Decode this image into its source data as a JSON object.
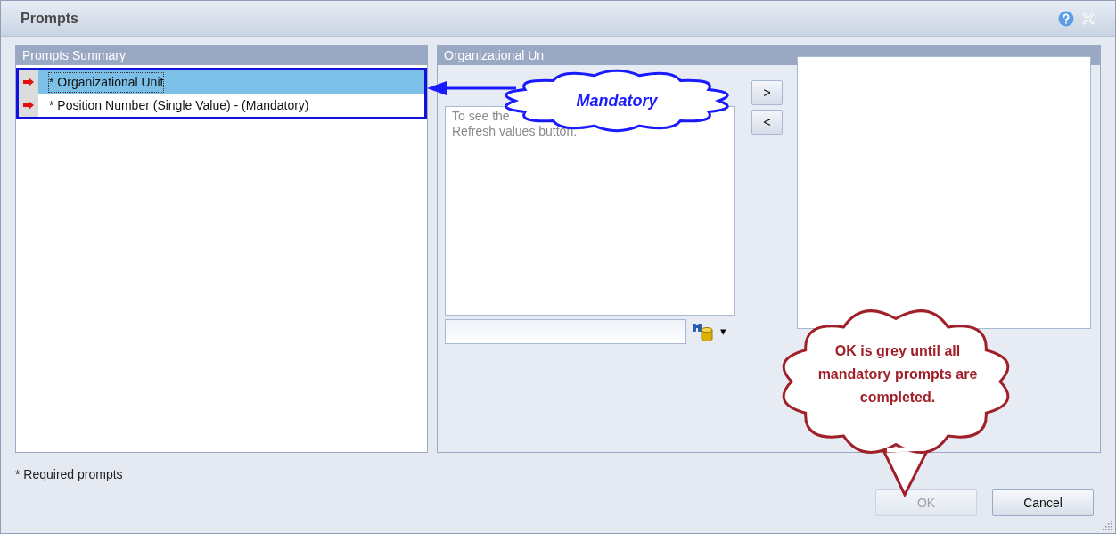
{
  "window": {
    "title": "Prompts"
  },
  "prompts_summary": {
    "title": "Prompts Summary",
    "items": [
      {
        "label": "* Organizational Unit",
        "selected": true
      },
      {
        "label": "* Position Number (Single Value) - (Mandatory)",
        "selected": false
      }
    ]
  },
  "prompt_panel": {
    "title": "Organizational Un",
    "hint_lines": [
      "To see the",
      "Refresh values button."
    ],
    "move_right": ">",
    "move_left": "<",
    "dropdown": "▾"
  },
  "footer": {
    "note": "* Required prompts",
    "buttons": [
      {
        "label": "OK",
        "disabled": true
      },
      {
        "label": "Cancel",
        "disabled": false
      }
    ]
  },
  "callouts": [
    {
      "kind": "arrow",
      "text": "Mandatory",
      "color": "#1a1aff"
    },
    {
      "kind": "tail",
      "text": "OK is grey until all mandatory prompts are completed.",
      "color": "#a0202a"
    }
  ]
}
